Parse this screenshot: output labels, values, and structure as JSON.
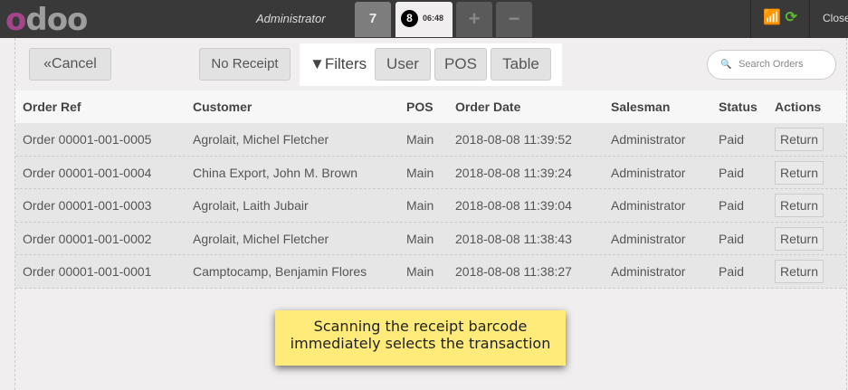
{
  "header": {
    "logo": "odoo",
    "user": "Administrator",
    "orders": [
      {
        "label": "7"
      },
      {
        "number": "8",
        "time": "06:48"
      }
    ],
    "add": "+",
    "remove": "−",
    "close": "Close",
    "status_color": "#5cb531"
  },
  "toolbar": {
    "cancel": "«Cancel",
    "no_receipt": "No Receipt",
    "filters": "Filters",
    "user": "User",
    "pos": "POS",
    "table": "Table",
    "search_placeholder": "Search Orders"
  },
  "table": {
    "columns": [
      "Order Ref",
      "Customer",
      "POS",
      "Order Date",
      "Salesman",
      "Status",
      "Actions"
    ],
    "rows": [
      [
        "Order 00001-001-0005",
        "Agrolait, Michel Fletcher",
        "Main",
        "2018-08-08 11:39:52",
        "Administrator",
        "Paid",
        "Return"
      ],
      [
        "Order 00001-001-0004",
        "China Export, John M. Brown",
        "Main",
        "2018-08-08 11:39:24",
        "Administrator",
        "Paid",
        "Return"
      ],
      [
        "Order 00001-001-0003",
        "Agrolait, Laith Jubair",
        "Main",
        "2018-08-08 11:39:04",
        "Administrator",
        "Paid",
        "Return"
      ],
      [
        "Order 00001-001-0002",
        "Agrolait, Michel Fletcher",
        "Main",
        "2018-08-08 11:38:43",
        "Administrator",
        "Paid",
        "Return"
      ],
      [
        "Order 00001-001-0001",
        "Camptocamp, Benjamin Flores",
        "Main",
        "2018-08-08 11:38:27",
        "Administrator",
        "Paid",
        "Return"
      ]
    ]
  },
  "note": {
    "line1": "Scanning the receipt barcode",
    "line2": "immediately selects the transaction"
  }
}
